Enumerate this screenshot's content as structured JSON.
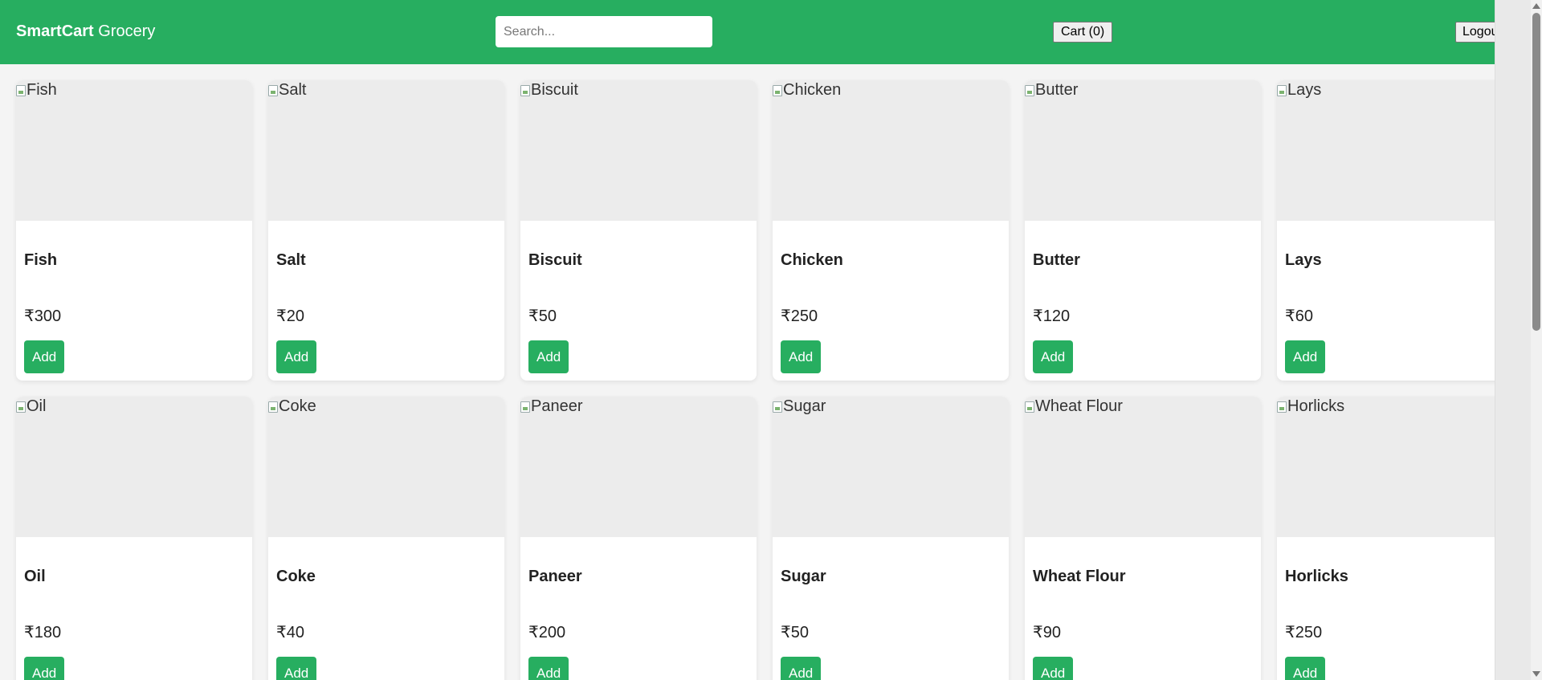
{
  "header": {
    "brand_bold": "SmartCart",
    "brand_rest": " Grocery",
    "search_placeholder": "Search...",
    "cart_label": "Cart (0)",
    "logout_label": "Logout"
  },
  "colors": {
    "primary": "#27ae60",
    "image_placeholder": "#ececec"
  },
  "products": [
    {
      "name": "Fish",
      "alt": "Fish",
      "price": "₹300",
      "button": "Add"
    },
    {
      "name": "Salt",
      "alt": "Salt",
      "price": "₹20",
      "button": "Add"
    },
    {
      "name": "Biscuit",
      "alt": "Biscuit",
      "price": "₹50",
      "button": "Add"
    },
    {
      "name": "Chicken",
      "alt": "Chicken",
      "price": "₹250",
      "button": "Add"
    },
    {
      "name": "Butter",
      "alt": "Butter",
      "price": "₹120",
      "button": "Add"
    },
    {
      "name": "Lays",
      "alt": "Lays",
      "price": "₹60",
      "button": "Add"
    },
    {
      "name": "Oil",
      "alt": "Oil",
      "price": "₹180",
      "button": "Add"
    },
    {
      "name": "Coke",
      "alt": "Coke",
      "price": "₹40",
      "button": "Add"
    },
    {
      "name": "Paneer",
      "alt": "Paneer",
      "price": "₹200",
      "button": "Add"
    },
    {
      "name": "Sugar",
      "alt": "Sugar",
      "price": "₹50",
      "button": "Add"
    },
    {
      "name": "Wheat Flour",
      "alt": "Wheat Flour",
      "price": "₹90",
      "button": "Add"
    },
    {
      "name": "Horlicks",
      "alt": "Horlicks",
      "price": "₹250",
      "button": "Add"
    }
  ]
}
